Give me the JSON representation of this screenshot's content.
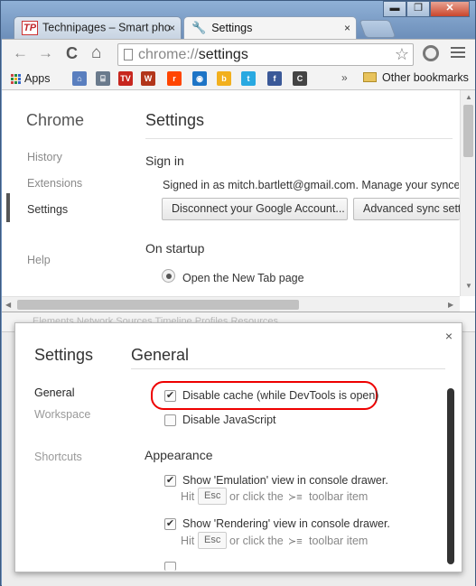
{
  "window": {
    "controls": {
      "minimize": "▬",
      "maximize": "❐",
      "close": "✕"
    }
  },
  "tabs": [
    {
      "label": "Technipages – Smart pho",
      "favicon": "TP",
      "close": "×"
    },
    {
      "label": "Settings",
      "favicon": "wrench-icon",
      "close": "×"
    }
  ],
  "toolbar": {
    "url_scheme": "chrome://",
    "url_path": "settings",
    "back": "←",
    "forward": "→",
    "reload": "C",
    "home": "⌂",
    "star": "☆"
  },
  "bookmarks": {
    "apps_label": "Apps",
    "overflow": "»",
    "other_label": "Other bookmarks",
    "icons": [
      {
        "name": "lighthouse-icon",
        "text": "⌂",
        "color": "#5a7fbf"
      },
      {
        "name": "toolkit-icon",
        "text": "⌸",
        "color": "#6a7a8c"
      },
      {
        "name": "tvguide-icon",
        "text": "TV",
        "color": "#c7261e"
      },
      {
        "name": "wowhead-icon",
        "text": "W",
        "color": "#b2361b"
      },
      {
        "name": "reddit-icon",
        "text": "r",
        "color": "#ff4500"
      },
      {
        "name": "eye-icon",
        "text": "◉",
        "color": "#1d74c6"
      },
      {
        "name": "bing-icon",
        "text": "b",
        "color": "#f2b01e"
      },
      {
        "name": "twitter-icon",
        "text": "t",
        "color": "#29a9e1"
      },
      {
        "name": "facebook-icon",
        "text": "f",
        "color": "#3b5998"
      },
      {
        "name": "nyt-icon",
        "text": "C",
        "color": "#444444"
      }
    ]
  },
  "settings_page": {
    "brand": "Chrome",
    "nav": [
      "History",
      "Extensions",
      "Settings",
      "Help"
    ],
    "title": "Settings",
    "signin_heading": "Sign in",
    "signin_text": "Signed in as mitch.bartlett@gmail.com. Manage your synced d",
    "disconnect_button": "Disconnect your Google Account...",
    "advanced_sync_button": "Advanced sync setti",
    "startup_heading": "On startup",
    "startup_option": "Open the New Tab page"
  },
  "devtools_tabs": "Elements  Network  Sources  Timeline  Profiles  Resources",
  "devtools_settings": {
    "close": "×",
    "title": "Settings",
    "nav": [
      "General",
      "Workspace",
      "Shortcuts"
    ],
    "section_title": "General",
    "disable_cache_label": "Disable cache (while DevTools is open)",
    "disable_cache_checked": true,
    "disable_js_label": "Disable JavaScript",
    "disable_js_checked": false,
    "appearance_heading": "Appearance",
    "emulation_label": "Show 'Emulation' view in console drawer.",
    "emulation_checked": true,
    "rendering_label": "Show 'Rendering' view in console drawer.",
    "rendering_checked": true,
    "hint_prefix": "Hit",
    "hint_key": "Esc",
    "hint_middle": "or click the",
    "hint_suffix": "toolbar item",
    "check_mark": "✔"
  }
}
